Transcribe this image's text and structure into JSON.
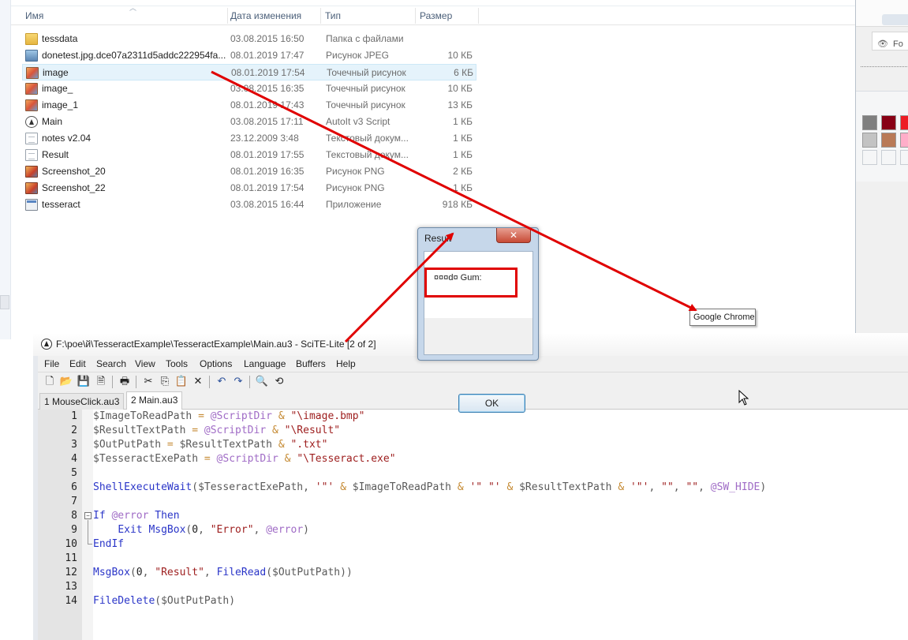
{
  "explorer": {
    "columns": {
      "name": "Имя",
      "date": "Дата изменения",
      "type": "Тип",
      "size": "Размер"
    },
    "files": [
      {
        "name": "tessdata",
        "date": "03.08.2015 16:50",
        "type": "Папка с файлами",
        "size": "",
        "icon": "folder-icon"
      },
      {
        "name": "donetest.jpg.dce07a2311d5addc222954fa...",
        "date": "08.01.2019 17:47",
        "type": "Рисунок JPEG",
        "size": "10 КБ",
        "icon": "jpeg-file-icon"
      },
      {
        "name": "image",
        "date": "08.01.2019 17:54",
        "type": "Точечный рисунок",
        "size": "6 КБ",
        "icon": "bitmap-file-icon"
      },
      {
        "name": "image_",
        "date": "03.08.2015 16:35",
        "type": "Точечный рисунок",
        "size": "10 КБ",
        "icon": "bitmap-file-icon"
      },
      {
        "name": "image_1",
        "date": "08.01.2019 17:43",
        "type": "Точечный рисунок",
        "size": "13 КБ",
        "icon": "bitmap-file-icon"
      },
      {
        "name": "Main",
        "date": "03.08.2015 17:11",
        "type": "AutoIt v3 Script",
        "size": "1 КБ",
        "icon": "autoit-script-icon"
      },
      {
        "name": "notes v2.04",
        "date": "23.12.2009 3:48",
        "type": "Текстовый докум...",
        "size": "1 КБ",
        "icon": "text-file-icon"
      },
      {
        "name": "Result",
        "date": "08.01.2019 17:55",
        "type": "Текстовый докум...",
        "size": "1 КБ",
        "icon": "text-file-icon"
      },
      {
        "name": "Screenshot_20",
        "date": "08.01.2019 16:35",
        "type": "Рисунок PNG",
        "size": "2 КБ",
        "icon": "png-file-icon"
      },
      {
        "name": "Screenshot_22",
        "date": "08.01.2019 17:54",
        "type": "Рисунок PNG",
        "size": "1 КБ",
        "icon": "png-file-icon"
      },
      {
        "name": "tesseract",
        "date": "03.08.2015 16:44",
        "type": "Приложение",
        "size": "918 КБ",
        "icon": "application-icon"
      }
    ],
    "selected_file": "image"
  },
  "right_window": {
    "tab_label": "Fo"
  },
  "tooltip": {
    "text": "Google Chrome"
  },
  "msgbox": {
    "title": "Result",
    "close": "✕",
    "text": "¤¤¤d¤ Gum:",
    "ok": "OK"
  },
  "scite": {
    "title": "F:\\poe\\й\\TesseractExample\\TesseractExample\\Main.au3 - SciTE-Lite [2 of 2]",
    "menu": [
      "File",
      "Edit",
      "Search",
      "View",
      "Tools",
      "Options",
      "Language",
      "Buffers",
      "Help"
    ],
    "tabs": [
      "1 MouseClick.au3",
      "2 Main.au3"
    ],
    "active_tab": "2 Main.au3",
    "line_numbers": [
      "1",
      "2",
      "3",
      "4",
      "5",
      "6",
      "7",
      "8",
      "9",
      "10",
      "11",
      "12",
      "13",
      "14"
    ],
    "code": [
      "$ImageToReadPath = @ScriptDir & \"\\image.bmp\"",
      "$ResultTextPath = @ScriptDir & \"\\Result\"",
      "$OutPutPath = $ResultTextPath & \".txt\"",
      "$TesseractExePath = @ScriptDir & \"\\Tesseract.exe\"",
      "",
      "ShellExecuteWait($TesseractExePath, '\"' & $ImageToReadPath & '\" \"' & $ResultTextPath & '\"', \"\", \"\", @SW_HIDE)",
      "",
      "If @error Then",
      "    Exit MsgBox(0, \"Error\", @error)",
      "EndIf",
      "",
      "MsgBox(0, \"Result\", FileRead($OutPutPath))",
      "",
      "FileDelete($OutPutPath)"
    ]
  },
  "colors": {
    "annotation_red": "#e00000",
    "keyword_blue": "#2a35c8",
    "string_red": "#9d1d1d",
    "macro_purple": "#a06cc6",
    "operator_orange": "#c58a33"
  }
}
